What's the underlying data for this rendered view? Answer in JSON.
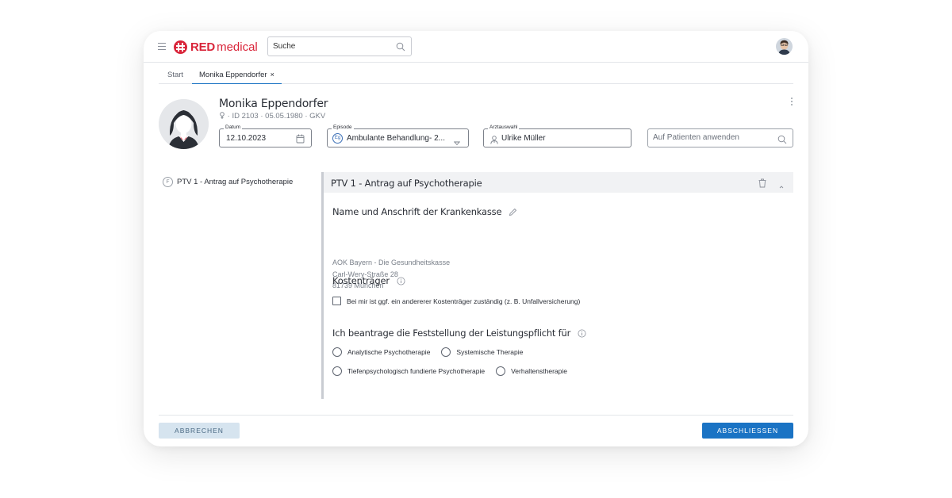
{
  "app": {
    "logo_bold": "RED",
    "logo_light": "medical",
    "brand_color": "#d9253a",
    "accent_color": "#1a73c4"
  },
  "search": {
    "placeholder": "Suche"
  },
  "tabs": [
    {
      "label": "Start",
      "active": false
    },
    {
      "label": "Monika Eppendorfer",
      "close": "×",
      "active": true
    }
  ],
  "patient": {
    "name": "Monika Eppendorfer",
    "gender_icon": "female-icon",
    "meta": "· ID 2103 · 05.05.1980 · GKV"
  },
  "fields": {
    "date": {
      "label": "Datum",
      "value": "12.10.2023"
    },
    "episode": {
      "label": "Episode",
      "badge": "Eg",
      "value": "Ambulante Behandlung- 2..."
    },
    "arzt": {
      "label": "Arztauswahl",
      "value": "Ulrike Müller"
    },
    "apply": {
      "placeholder": "Auf Patienten anwenden"
    }
  },
  "leftnav": {
    "items": [
      {
        "badge": "F",
        "label": "PTV 1 - Antrag auf Psychotherapie"
      }
    ]
  },
  "panel": {
    "title": "PTV 1 - Antrag auf Psychotherapie",
    "sections": {
      "kasse": {
        "title": "Name und Anschrift der Krankenkasse",
        "lines": [
          "AOK Bayern - Die Gesundheitskasse",
          "Carl-Wery-Straße 28",
          "81739 München"
        ]
      },
      "kosten": {
        "title": "Kostenträger",
        "checkbox_label": "Bei mir ist ggf. ein andererer Kostenträger zuständig (z. B. Unfallversicherung)",
        "checked": false
      },
      "leistung": {
        "title": "Ich beantrage die Feststellung der Leistungspflicht für",
        "options": [
          "Analytische Psychotherapie",
          "Systemische Therapie",
          "Tiefenpsychologisch fundierte Psychotherapie",
          "Verhaltenstherapie"
        ]
      }
    }
  },
  "footer": {
    "cancel_label": "ABBRECHEN",
    "finish_label": "ABSCHLIESSEN"
  }
}
